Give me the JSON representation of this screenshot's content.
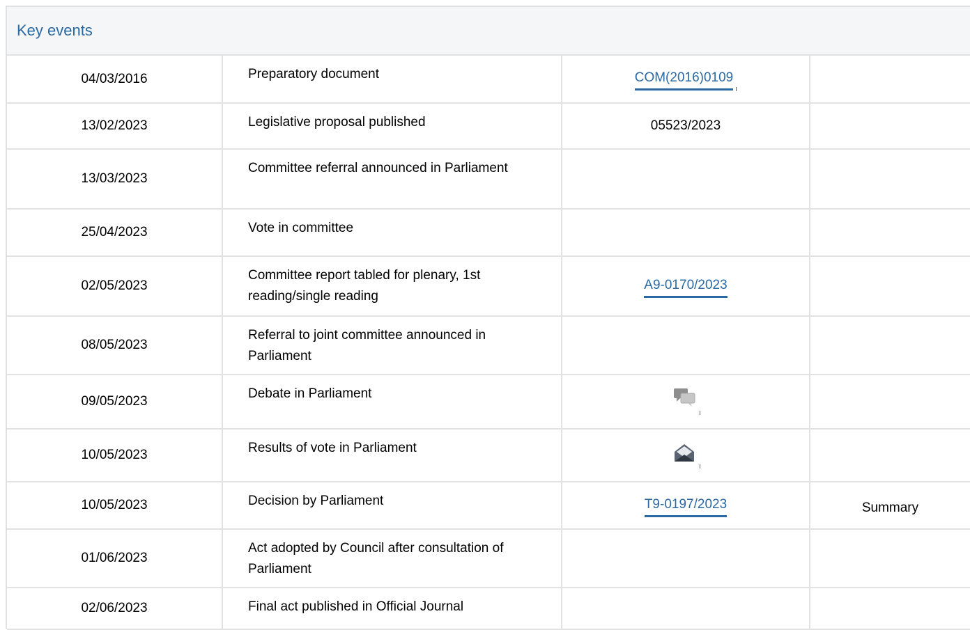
{
  "panel": {
    "title": "Key events"
  },
  "events": [
    {
      "date": "04/03/2016",
      "event": "Preparatory document",
      "doc": "COM(2016)0109",
      "summary": ""
    },
    {
      "date": "13/02/2023",
      "event": "Legislative proposal published",
      "doc": "05523/2023",
      "summary": ""
    },
    {
      "date": "13/03/2023",
      "event": "Committee referral announced in Parliament",
      "doc": "",
      "summary": ""
    },
    {
      "date": "25/04/2023",
      "event": "Vote in committee",
      "doc": "",
      "summary": ""
    },
    {
      "date": "02/05/2023",
      "event": "Committee report tabled for plenary, 1st reading/single reading",
      "doc": "A9-0170/2023",
      "summary": ""
    },
    {
      "date": "08/05/2023",
      "event": "Referral to joint committee announced in Parliament",
      "doc": "",
      "summary": ""
    },
    {
      "date": "09/05/2023",
      "event": "Debate in Parliament",
      "doc_icon": "debate-icon",
      "summary": ""
    },
    {
      "date": "10/05/2023",
      "event": "Results of vote in Parliament",
      "doc_icon": "vote-results-icon",
      "summary": ""
    },
    {
      "date": "10/05/2023",
      "event": "Decision by Parliament",
      "doc": "T9-0197/2023",
      "summary": "Summary"
    },
    {
      "date": "01/06/2023",
      "event": "Act adopted by Council after consultation of Parliament",
      "doc": "",
      "summary": ""
    },
    {
      "date": "02/06/2023",
      "event": "Final act published in Official Journal",
      "doc": "",
      "summary": ""
    }
  ],
  "colors": {
    "link": "#2a69a3",
    "border": "#e2e2e2",
    "header_bg": "#f5f6f7"
  }
}
